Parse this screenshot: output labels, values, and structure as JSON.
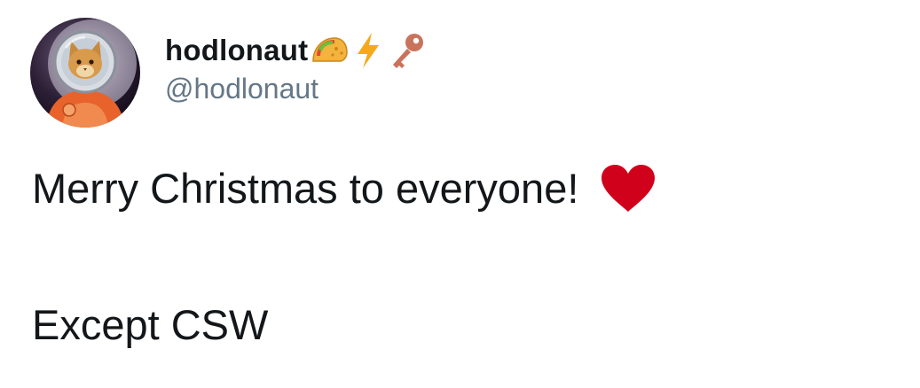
{
  "tweet": {
    "author": {
      "display_name": "hodlonaut",
      "handle": "@hodlonaut",
      "name_emojis": [
        "taco-icon",
        "lightning-icon",
        "key-icon"
      ],
      "avatar": "astronaut-cat-avatar"
    },
    "lines": [
      "Merry Christmas to everyone!",
      "",
      "Except CSW"
    ],
    "inline_emoji": "heart-icon"
  },
  "colors": {
    "text": "#14171a",
    "handle": "#657786",
    "heart": "#d0021b",
    "lightning": "#f4a91c",
    "key": "#c9735c",
    "taco": "#f3b33d",
    "spacesuit": "#e8632b"
  }
}
